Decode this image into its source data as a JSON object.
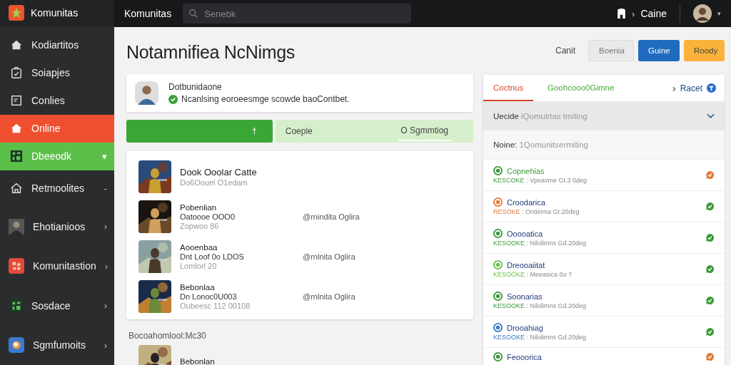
{
  "sidebar": {
    "brand": "Komunitas",
    "items": [
      {
        "label": "Kodiartitos",
        "selected": false,
        "highlighted": false
      },
      {
        "label": "Soiapjes",
        "selected": false,
        "highlighted": false
      },
      {
        "label": "Conlies",
        "selected": false,
        "highlighted": false
      },
      {
        "label": "Online",
        "selected": true,
        "highlighted": false
      },
      {
        "label": "Dbeeodk",
        "selected": false,
        "highlighted": true,
        "chevron": "▾"
      },
      {
        "label": "Retmoolites",
        "selected": false,
        "highlighted": false,
        "chevron": "-"
      },
      {
        "label": "Ehotianioos",
        "selected": false,
        "highlighted": false,
        "chevron": "›"
      },
      {
        "label": "Komunitastion",
        "selected": false,
        "highlighted": false,
        "chevron": "›"
      },
      {
        "label": "Sosdace",
        "selected": false,
        "highlighted": false,
        "chevron": "›"
      },
      {
        "label": "Sgmfumoits",
        "selected": false,
        "highlighted": false,
        "chevron": "›"
      }
    ]
  },
  "topbar": {
    "title": "Komunitas",
    "search": {
      "placeholder": "Senebk"
    },
    "breadcrumb_separator": "›",
    "breadcrumb": "Caine",
    "menu_caret": "▾"
  },
  "page": {
    "title": "Notamnifiea NcNimgs",
    "link": "Canit",
    "buttons": [
      {
        "label": "Boenia",
        "kind": "secondary"
      },
      {
        "label": "Guine",
        "kind": "primary"
      },
      {
        "label": "Roody",
        "kind": "warning"
      }
    ]
  },
  "profile": {
    "name": "Dotbunidaone",
    "status": "Ncanlsing eoroeesmge scowde baoContbet.",
    "verified": true
  },
  "tabs": [
    {
      "label": "†",
      "selected": true,
      "underlined": false
    },
    {
      "label": "Coeple",
      "selected": false,
      "underlined": false
    },
    {
      "label": "O Sgmmtiog",
      "selected": false,
      "underlined": true
    }
  ],
  "games": [
    {
      "title": "Dook Ooolar Catte",
      "lines": [
        "Do6Oouel O1edam"
      ]
    },
    {
      "title": "Pobenlian",
      "lines": [
        "Oatoooe OOO0",
        "Zopwoo 86"
      ],
      "status": "@rnindita Oglira"
    },
    {
      "title": "Aooenbaa",
      "lines": [
        "Dnt Loof 0o LDOS",
        "Lomlorl 20"
      ],
      "status": "@rnlnita Oglira"
    },
    {
      "title": "Bebonlaa",
      "lines": [
        "Dn Lonoc0U003",
        "Oubeesc 112 00108"
      ],
      "status": "@rnlnita Oglira"
    }
  ],
  "section": {
    "title": "Bocoahomlool:Mc30",
    "games": [
      {
        "title": "Bebonlan"
      }
    ]
  },
  "panel": {
    "tabs": [
      {
        "label": "Coctnus",
        "selected": true
      },
      {
        "label": "Goohcooo0Gimne",
        "selected": false
      }
    ],
    "action": {
      "label": "Racet",
      "chevron": "›"
    },
    "filter": {
      "label": "Uecide",
      "value": "iQomulrtas tmiting"
    },
    "name_row": {
      "label": "Noine:",
      "value": "1Qomunitsermiting"
    },
    "items": [
      {
        "name": "Copnehias",
        "prefix": "KESCOKE",
        "detail": ": Vpeavme Gt.3 0deg",
        "color": "#3a9a3a",
        "alert": true
      },
      {
        "name": "Croodarica",
        "prefix": "RESOKE",
        "detail": ": Ontiéima Gt.20deg",
        "color": "#e07a3a",
        "alert": false
      },
      {
        "name": "Ooooatica",
        "prefix": "KESOOKE",
        "detail": ": Nilolimns Gd.20deg",
        "color": "#3a9a3a",
        "alert": false
      },
      {
        "name": "Dreooaiitat",
        "prefix": "KESOOKE",
        "detail": ": Meeasica 0o ?",
        "color": "#6abf4b",
        "alert": false
      },
      {
        "name": "Soonarias",
        "prefix": "KESOOKE",
        "detail": ": Nilolimns Gd.20deg",
        "color": "#3a9a3a",
        "alert": false
      },
      {
        "name": "Drooahiag",
        "prefix": "KESOOKE",
        "detail": ": Nilolimns Gd.20deg",
        "color": "#3a78c8",
        "alert": false
      },
      {
        "name": "Feooorica",
        "color": "#3a9a3a",
        "alert": true
      }
    ]
  }
}
